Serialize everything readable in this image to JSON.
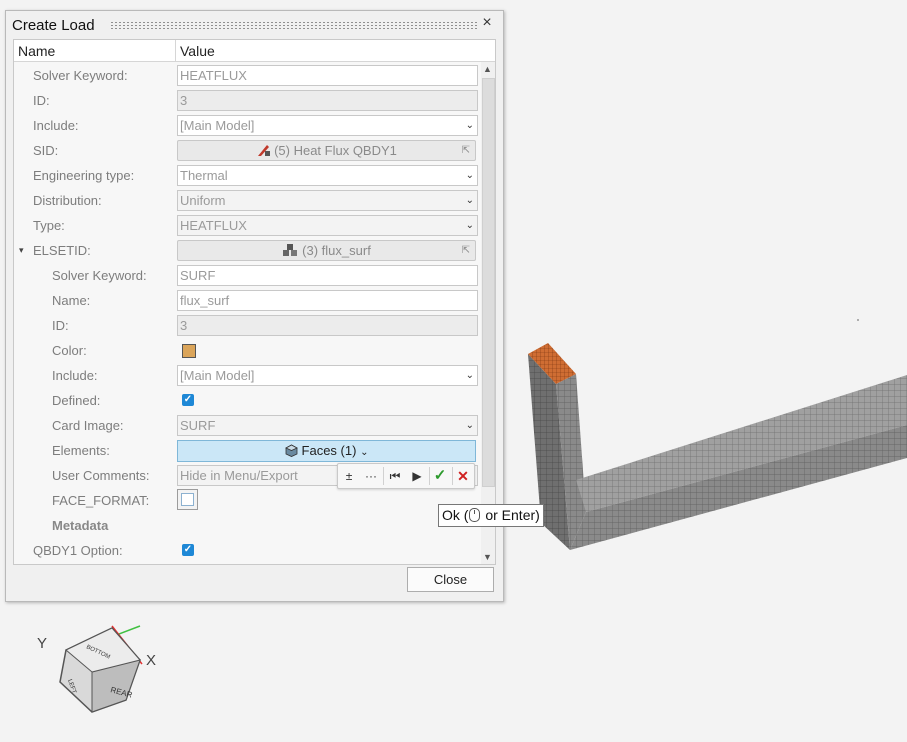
{
  "dialog": {
    "title": "Create Load",
    "close_glyph": "×",
    "close_button": "Close"
  },
  "grid": {
    "col_name": "Name",
    "col_value": "Value"
  },
  "rows": {
    "solver_keyword": {
      "label": "Solver Keyword:",
      "value": "HEATFLUX"
    },
    "id": {
      "label": "ID:",
      "value": "3"
    },
    "include": {
      "label": "Include:",
      "value": "[Main Model]"
    },
    "sid": {
      "label": "SID:",
      "value": "(5)  Heat Flux QBDY1",
      "icon": "load-icon"
    },
    "engineering_type": {
      "label": "Engineering type:",
      "value": "Thermal"
    },
    "distribution": {
      "label": "Distribution:",
      "value": "Uniform"
    },
    "type": {
      "label": "Type:",
      "value": "HEATFLUX"
    },
    "elsetid": {
      "label": "ELSETID:",
      "value": "(3) flux_surf",
      "icon": "set-icon"
    },
    "sub_solver_keyword": {
      "label": "Solver Keyword:",
      "value": "SURF"
    },
    "sub_name": {
      "label": "Name:",
      "value": "flux_surf"
    },
    "sub_id": {
      "label": "ID:",
      "value": "3"
    },
    "sub_color": {
      "label": "Color:",
      "value": "#dba55a"
    },
    "sub_include": {
      "label": "Include:",
      "value": "[Main Model]"
    },
    "sub_defined": {
      "label": "Defined:",
      "checked": true
    },
    "sub_card_image": {
      "label": "Card Image:",
      "value": "SURF"
    },
    "sub_elements": {
      "label": "Elements:",
      "value": "Faces (1)",
      "icon": "cube-icon"
    },
    "sub_user_comments": {
      "label": "User Comments:",
      "value": "Hide in Menu/Export"
    },
    "sub_face_format": {
      "label": "FACE_FORMAT:",
      "checked": false
    },
    "metadata": {
      "label": "Metadata"
    },
    "qbdy1_option": {
      "label": "QBDY1 Option:",
      "checked": true
    }
  },
  "selection_toolbar": {
    "tooltip_prefix": "Ok (",
    "tooltip_suffix": " or Enter)",
    "icons": [
      "add-remove-icon",
      "more-icon",
      "reset-icon",
      "next-icon",
      "ok-icon",
      "cancel-icon"
    ]
  },
  "axes": {
    "y_label": "Y",
    "x_label": "X",
    "cube_faces": [
      "REAR",
      "BOTTOM",
      "LEFT"
    ]
  },
  "colors": {
    "accent": "#1e88d6",
    "selected_faces": "#cbe7f7",
    "mesh": "#8c8c8c",
    "flux_surface": "#d0743a"
  }
}
